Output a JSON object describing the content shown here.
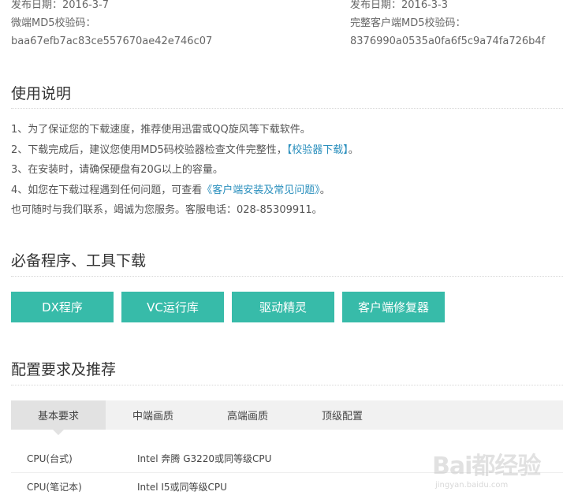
{
  "top_info": {
    "left": {
      "release_date": "发布日期：2016-3-7",
      "md5_label": "微端MD5校验码：",
      "md5_value": "baa67efb7ac83ce557670ae42e746c07"
    },
    "right": {
      "release_date": "发布日期：2016-3-3",
      "md5_label": "完整客户端MD5校验码：",
      "md5_value": "8376990a0535a0fa6f5c9a74fa726b4f"
    }
  },
  "usage": {
    "title": "使用说明",
    "line1": "1、为了保证您的下载速度，推荐使用迅雷或QQ旋风等下载软件。",
    "line2_pre": "2、下载完成后，建议您使用MD5码校验器检查文件完整性，",
    "line2_link": "【校验器下载】",
    "line2_post": "。",
    "line3": "3、在安装时，请确保硬盘有20G以上的容量。",
    "line4_pre": "4、如您在下载过程遇到任何问题，可查看",
    "line4_link": "《客户端安装及常见问题》",
    "line4_post": "。",
    "line5": "也可随时与我们联系，竭诚为您服务。客服电话：028-85309911。"
  },
  "tools": {
    "title": "必备程序、工具下载",
    "buttons": [
      "DX程序",
      "VC运行库",
      "驱动精灵",
      "客户端修复器"
    ]
  },
  "config": {
    "title": "配置要求及推荐",
    "tabs": [
      "基本要求",
      "中端画质",
      "高端画质",
      "顶级配置"
    ],
    "active_tab": 0,
    "rows": [
      {
        "key": "CPU(台式)",
        "value": "Intel 奔腾 G3220或同等级CPU"
      },
      {
        "key": "CPU(笔记本)",
        "value": "Intel I5或同等级CPU"
      }
    ]
  },
  "watermark": {
    "logo": "Bai都经验",
    "url": "jingyan.baidu.com"
  },
  "colors": {
    "accent": "#37bba9",
    "link": "#2a8fbd"
  }
}
